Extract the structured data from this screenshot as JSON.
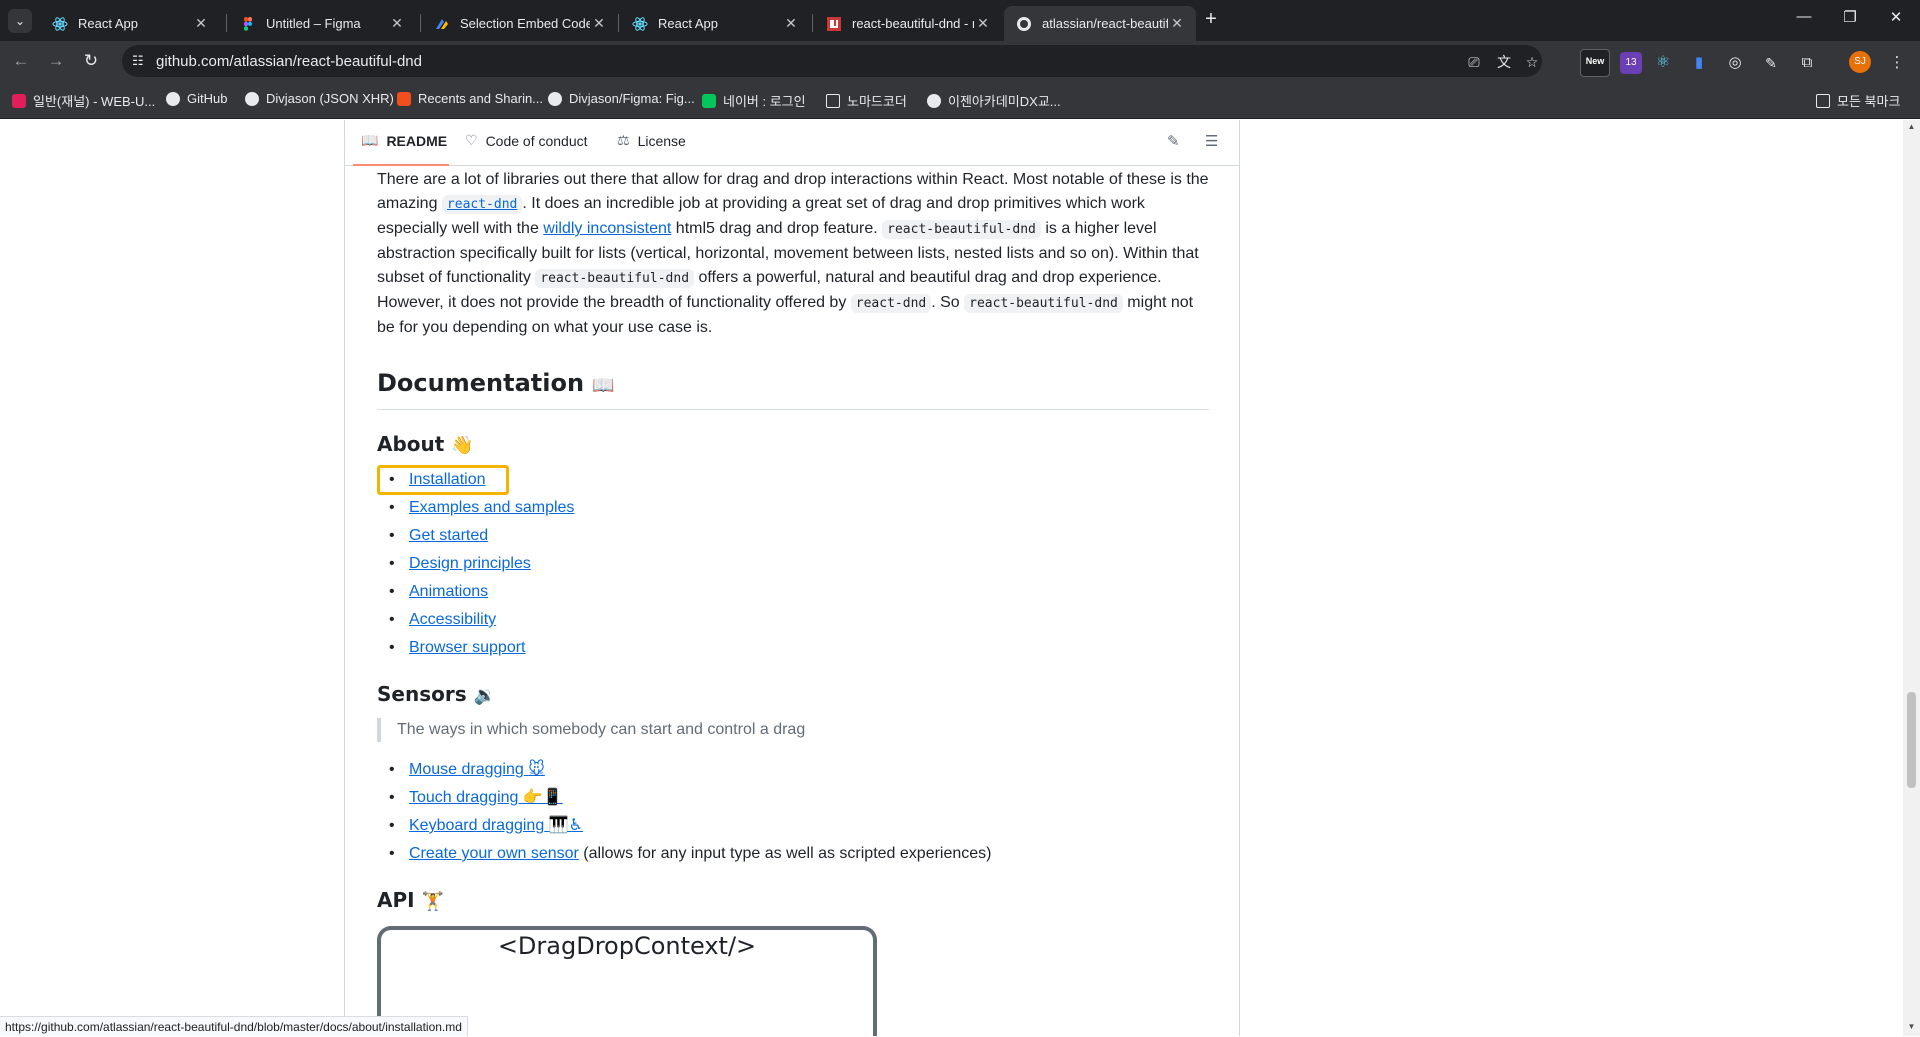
{
  "browser": {
    "tabs": [
      {
        "title": "React App",
        "icon": "react-icon",
        "color": "#61dafb"
      },
      {
        "title": "Untitled – Figma",
        "icon": "figma-icon",
        "color": "#f24e1e"
      },
      {
        "title": "Selection Embed Code - Goo",
        "icon": "apps-script-icon",
        "color": "#4285f4"
      },
      {
        "title": "React App",
        "icon": "react-icon",
        "color": "#61dafb"
      },
      {
        "title": "react-beautiful-dnd - npm",
        "icon": "npm-icon",
        "color": "#cb3837"
      },
      {
        "title": "atlassian/react-beautiful-dnd: B",
        "icon": "github-icon",
        "color": "#ffffff"
      }
    ],
    "url": "github.com/atlassian/react-beautiful-dnd",
    "extensions_badge": "13",
    "new_badge": "New",
    "profile_initials": "SJ",
    "bookmarks": [
      {
        "label": "일반(재널) - WEB-U...",
        "color": "#e01e5a"
      },
      {
        "label": "GitHub",
        "color": "#e8eaed"
      },
      {
        "label": "Divjason (JSON XHR)",
        "color": "#e8eaed"
      },
      {
        "label": "Recents and Sharin...",
        "color": "#f24e1e"
      },
      {
        "label": "Divjason/Figma: Fig...",
        "color": "#e8eaed"
      },
      {
        "label": "네이버 : 로그인",
        "color": "#03c75a"
      },
      {
        "label": "노마드코더",
        "color": "#e8eaed"
      },
      {
        "label": "이젠아카데미DX교...",
        "color": "#e8eaed"
      }
    ],
    "all_bookmarks": "모든 북마크",
    "status_url": "https://github.com/atlassian/react-beautiful-dnd/blob/master/docs/about/installation.md"
  },
  "readme_tabs": {
    "readme": "README",
    "code_of_conduct": "Code of conduct",
    "license": "License"
  },
  "intro": {
    "t1": "There are a lot of libraries out there that allow for drag and drop interactions within React. Most notable of these is the amazing ",
    "code1": "react-dnd",
    "t2": ". It does an incredible job at providing a great set of drag and drop primitives which work especially well with the ",
    "link1": "wildly inconsistent",
    "t3": " html5 drag and drop feature. ",
    "code2": "react-beautiful-dnd",
    "t4": " is a higher level abstraction specifically built for lists (vertical, horizontal, movement between lists, nested lists and so on). Within that subset of functionality ",
    "code3": "react-beautiful-dnd",
    "t5": " offers a powerful, natural and beautiful drag and drop experience. However, it does not provide the breadth of functionality offered by ",
    "code4": "react-dnd",
    "t6": ". So ",
    "code5": "react-beautiful-dnd",
    "t7": " might not be for you depending on what your use case is."
  },
  "documentation": {
    "heading": "Documentation",
    "heading_emoji": "📖",
    "about": {
      "heading": "About",
      "emoji": "👋",
      "links": [
        "Installation",
        "Examples and samples",
        "Get started",
        "Design principles",
        "Animations",
        "Accessibility",
        "Browser support"
      ]
    },
    "sensors": {
      "heading": "Sensors",
      "emoji": "🔉",
      "quote": "The ways in which somebody can start and control a drag",
      "items": [
        {
          "link": "Mouse dragging",
          "emoji": "🐭",
          "suffix": ""
        },
        {
          "link": "Touch dragging",
          "emoji": "👉📱",
          "suffix": ""
        },
        {
          "link": "Keyboard dragging",
          "emoji": "🎹♿",
          "suffix": ""
        },
        {
          "link": "Create your own sensor",
          "emoji": "",
          "suffix": " (allows for any input type as well as scripted experiences)"
        }
      ]
    },
    "api": {
      "heading": "API",
      "emoji": "🏋️",
      "diagram_title": "<DragDropContext/>"
    }
  }
}
